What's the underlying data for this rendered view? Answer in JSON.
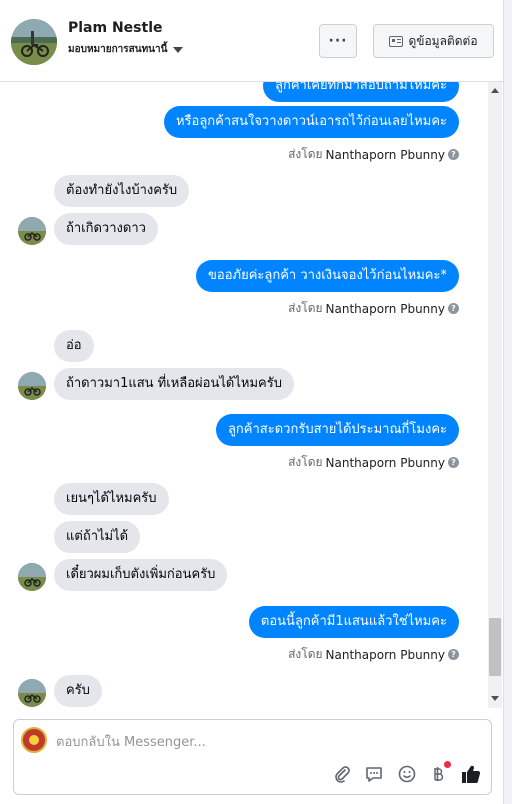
{
  "header": {
    "page_name": "Plam Nestle",
    "assign_label": "มอบหมายการสนทนานี้",
    "more_label": "···",
    "contact_label": "ดูข้อมูลติดต่อ"
  },
  "conversation": {
    "sent_by_prefix": "ส่งโดย",
    "sender_name": "Nanthaporn Pbunny",
    "messages": [
      {
        "dir": "out",
        "text": "ลูกค้าเคยทักมาสอบถามไหมคะ"
      },
      {
        "dir": "out",
        "text": "หรือลูกค้าสนใจวางดาวน์เอารถไว้ก่อนเลยไหมคะ"
      },
      {
        "dir": "in",
        "text": "ต้องทำยังไงบ้างครับ"
      },
      {
        "dir": "in",
        "text": "ถ้าเกิดวางดาว"
      },
      {
        "dir": "out",
        "text": "ขออภัยค่ะลูกค้า วางเงินจองไว้ก่อนไหมคะ*"
      },
      {
        "dir": "in",
        "text": "อ่อ"
      },
      {
        "dir": "in",
        "text": "ถ้าดาวมา1แสน ที่เหลือผ่อนได้ไหมครับ"
      },
      {
        "dir": "out",
        "text": "ลูกค้าสะดวกรับสายได้ประมาณกี่โมงคะ"
      },
      {
        "dir": "in",
        "text": "เยนๆได้ไหมครับ"
      },
      {
        "dir": "in",
        "text": "แต่ถ้าไม่ได้"
      },
      {
        "dir": "in",
        "text": "เดี๋ยวผมเก็บตังเพิ่มก่อนครับ"
      },
      {
        "dir": "out",
        "text": "ตอนนี้ลูกค้ามี1แสนแล้วใช่ไหมคะ"
      },
      {
        "dir": "in",
        "text": "ครับ"
      }
    ]
  },
  "composer": {
    "placeholder": "ตอบกลับใน Messenger...",
    "tools": [
      "paperclip-icon",
      "saved-reply-icon",
      "emoji-icon",
      "baht-payment-icon",
      "like-icon"
    ]
  },
  "colors": {
    "outgoing_bubble": "#0084ff",
    "incoming_bubble": "#e4e6eb",
    "notification_dot": "#f02849"
  }
}
